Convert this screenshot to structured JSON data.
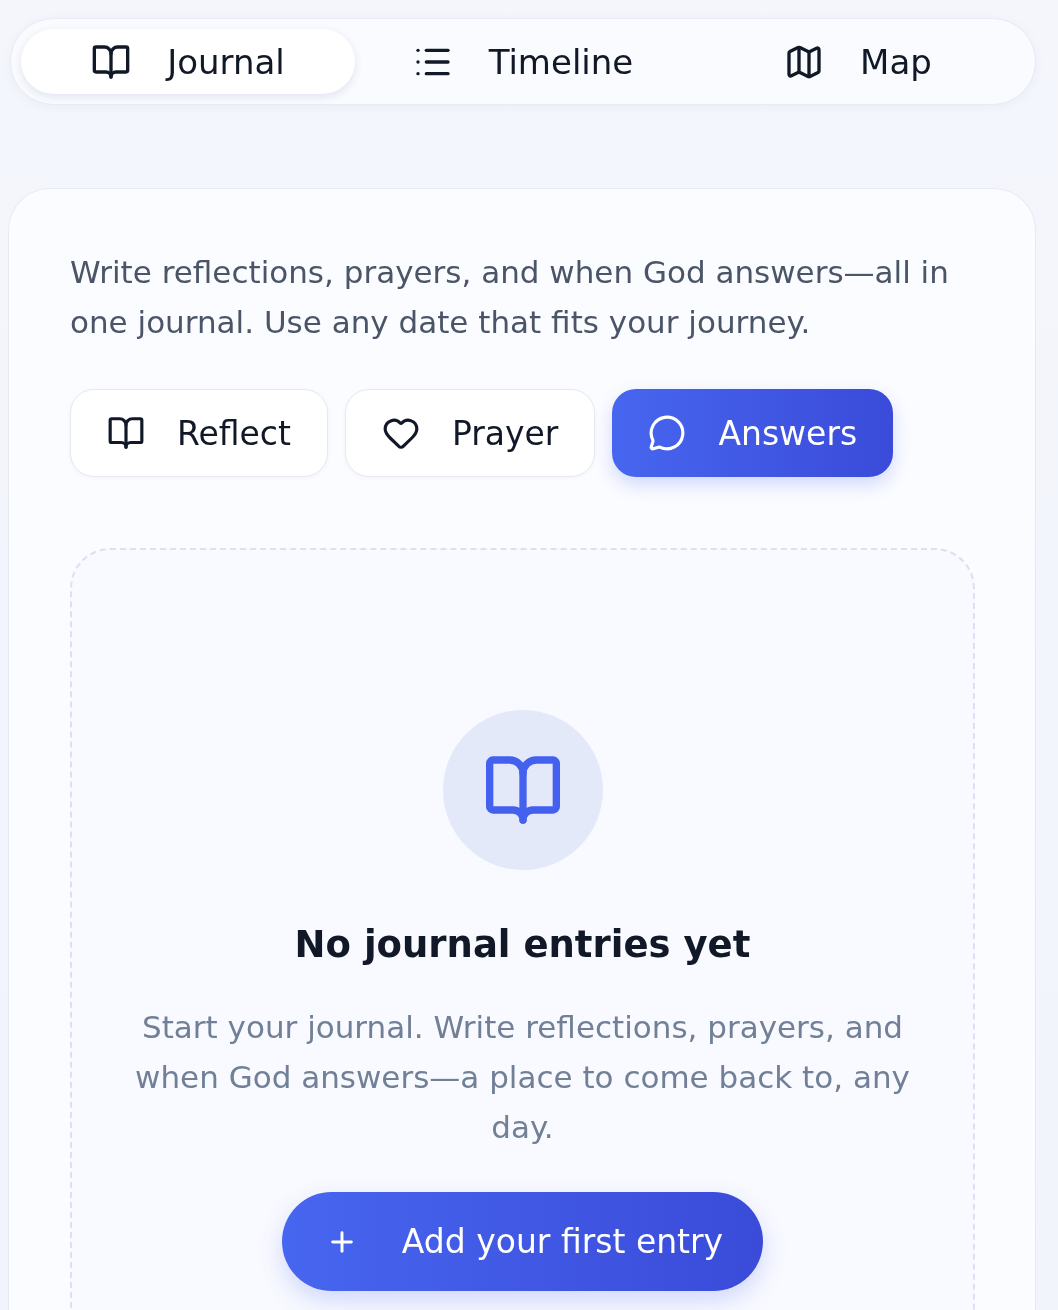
{
  "nav_tabs": [
    {
      "label": "Journal",
      "selected": true
    },
    {
      "label": "Timeline",
      "selected": false
    },
    {
      "label": "Map",
      "selected": false
    }
  ],
  "journal": {
    "description": "Write reflections, prayers, and when God answers—all in one journal. Use any date that fits your journey.",
    "entry_types": [
      {
        "label": "Reflect",
        "selected": false
      },
      {
        "label": "Prayer",
        "selected": false
      },
      {
        "label": "Answers",
        "selected": true
      }
    ],
    "empty_state": {
      "title": "No journal entries yet",
      "message": "Start your journal. Write reflections, prayers, and when God answers—a place to come back to, any day.",
      "button": "Add your first entry"
    }
  }
}
